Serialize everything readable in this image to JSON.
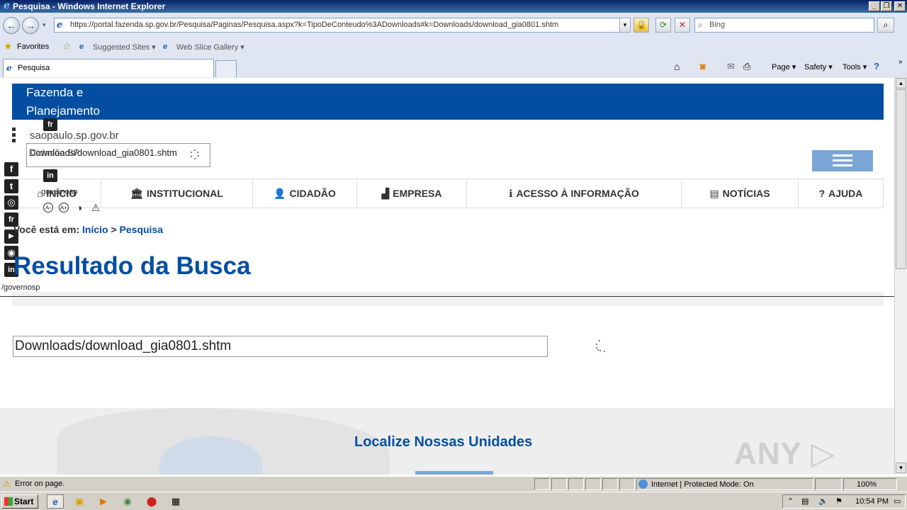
{
  "window": {
    "title": "Pesquisa - Windows Internet Explorer"
  },
  "browser": {
    "url": "https://portal.fazenda.sp.gov.br/Pesquisa/Paginas/Pesquisa.aspx?k=TipoDeConteudo%3ADownloads#k=Downloads/download_gia0801.shtm",
    "search_placeholder": "Bing",
    "favorites_label": "Favorites",
    "suggested_sites": "Suggested Sites ▾",
    "web_slice_gallery": "Web Slice Gallery ▾",
    "tab_title": "Pesquisa",
    "cmd_page": "Page ▾",
    "cmd_safety": "Safety ▾",
    "cmd_tools": "Tools ▾"
  },
  "site": {
    "header_line1": "Fazenda e",
    "header_line2": "Planejamento",
    "site_link": "saopaulo.sp.gov.br",
    "search_box_value": "Downloads/download_gia0801.shtm",
    "search_box_overlay": "Cidadão SP",
    "menu": [
      {
        "icon": "⌂",
        "label": "INÍCIO"
      },
      {
        "icon": "🏛",
        "label": "INSTITUCIONAL"
      },
      {
        "icon": "👤",
        "label": "CIDADÃO"
      },
      {
        "icon": "▟",
        "label": "EMPRESA"
      },
      {
        "icon": "ℹ",
        "label": "ACESSO À INFORMAÇÃO"
      },
      {
        "icon": "▤",
        "label": "NOTÍCIAS"
      },
      {
        "icon": "?",
        "label": "AJUDA"
      }
    ],
    "overlay_governosp": "governosp",
    "breadcrumb_prefix": "Você está em:",
    "breadcrumb_home": "Início",
    "breadcrumb_sep": ">",
    "breadcrumb_current": "Pesquisa",
    "page_title": "Resultado da Busca",
    "governosp_footer": "/governosp",
    "result_query": "Downloads/download_gia0801.shtm",
    "localize_title": "Localize Nossas Unidades",
    "social_left": [
      "f",
      "t",
      "◎",
      "fr",
      "▶",
      "◉",
      "in"
    ],
    "social_top": [
      "fr",
      "in"
    ]
  },
  "statusbar": {
    "message": "Error on page.",
    "zone": "Internet | Protected Mode: On",
    "zoom": "100%"
  },
  "taskbar": {
    "start": "Start",
    "clock": "10:54 PM"
  },
  "watermark": "ANY RUN"
}
